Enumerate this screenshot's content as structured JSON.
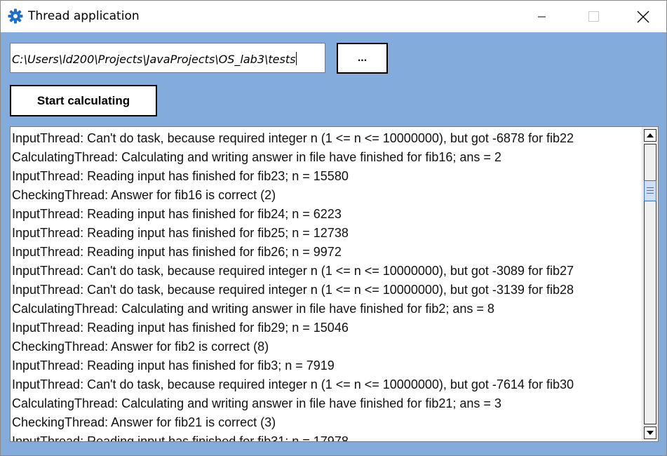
{
  "window": {
    "title": "Thread application",
    "icon": "gear-icon",
    "controls": [
      "minimize-icon",
      "maximize-icon",
      "close-icon"
    ]
  },
  "path_field": {
    "value": "C:\\Users\\ld200\\Projects\\JavaProjects\\OS_lab3\\tests"
  },
  "browse_button": {
    "label": "..."
  },
  "start_button": {
    "label": "Start calculating"
  },
  "log": {
    "lines": [
      "InputThread: Can't do task, because required integer n (1 <= n <= 10000000), but got -6878 for fib22",
      "CalculatingThread: Calculating and writing answer in file have finished for fib16; ans = 2",
      "InputThread: Reading input has finished for fib23; n = 15580",
      "CheckingThread: Answer for fib16 is correct (2)",
      "InputThread: Reading input has finished for fib24; n = 6223",
      "InputThread: Reading input has finished for fib25; n = 12738",
      "InputThread: Reading input has finished for fib26; n = 9972",
      "InputThread: Can't do task, because required integer n (1 <= n <= 10000000), but got -3089 for fib27",
      "InputThread: Can't do task, because required integer n (1 <= n <= 10000000), but got -3139 for fib28",
      "CalculatingThread: Calculating and writing answer in file have finished for fib2; ans = 8",
      "InputThread: Reading input has finished for fib29; n = 15046",
      "CheckingThread: Answer for fib2 is correct (8)",
      "InputThread: Reading input has finished for fib3; n = 7919",
      "InputThread: Can't do task, because required integer n (1 <= n <= 10000000), but got -7614 for fib30",
      "CalculatingThread: Calculating and writing answer in file have finished for fib21; ans = 3",
      "CheckingThread: Answer for fib21 is correct (3)",
      "InputThread: Reading input has finished for fib31; n = 17978"
    ]
  },
  "colors": {
    "client_background": "#83acdc",
    "titlebar": "#ffffff",
    "app_icon": "#1e6fc8"
  }
}
